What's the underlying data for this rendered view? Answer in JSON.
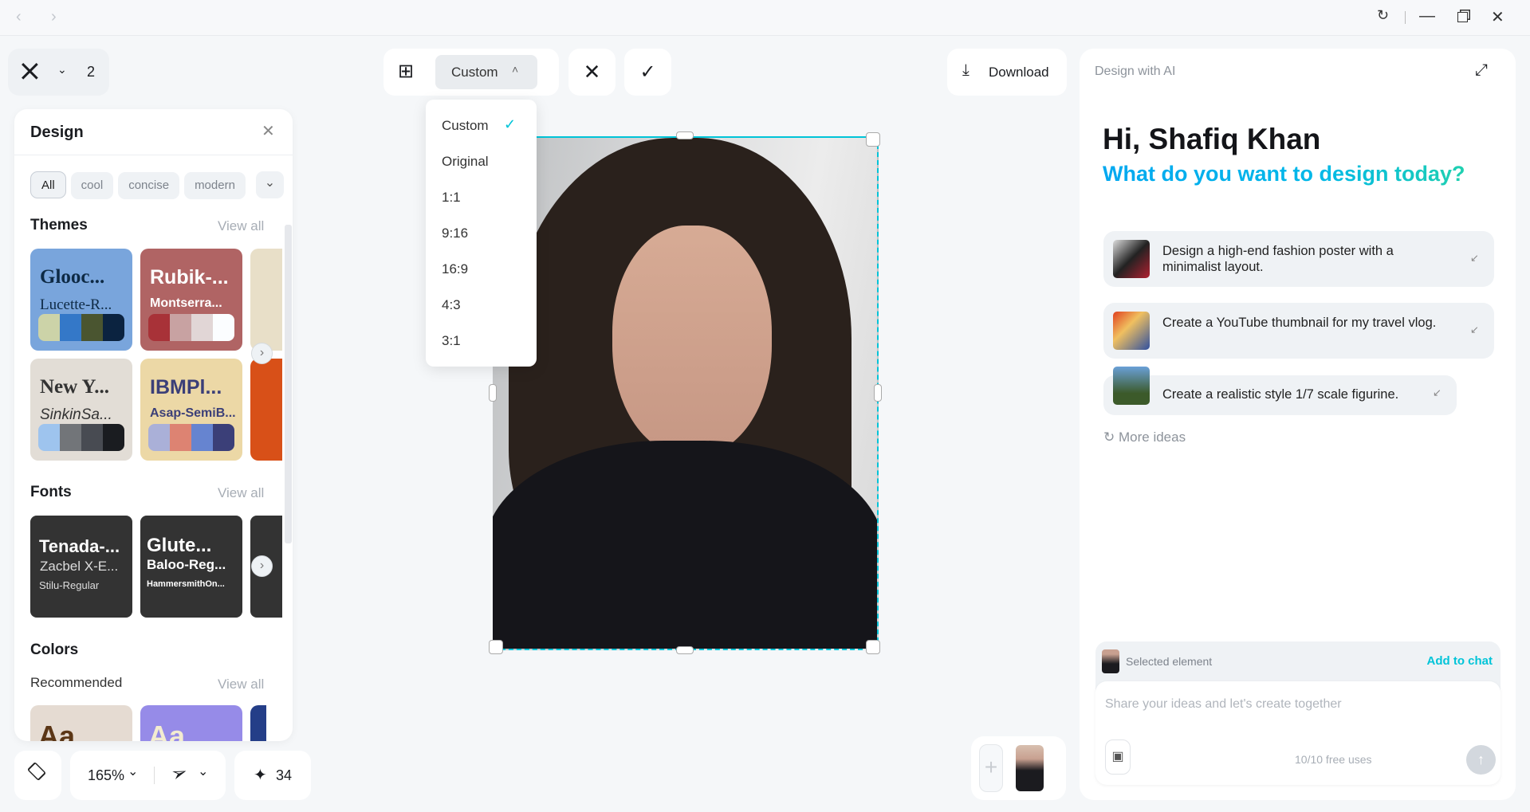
{
  "window": {
    "back_icon": "chevron-left",
    "forward_icon": "chevron-right",
    "controls": [
      "refresh",
      "minimize",
      "restore",
      "close"
    ]
  },
  "project": {
    "page_count": "2"
  },
  "design_panel": {
    "title": "Design",
    "filters": [
      "All",
      "cool",
      "concise",
      "modern"
    ],
    "themes": {
      "title": "Themes",
      "view_all": "View all",
      "items": [
        {
          "heading": "Glooc...",
          "sub": "Lucette-R...",
          "bg": "#79a5dc",
          "fg": "#0e2a45",
          "swatches": [
            "#ccd3a8",
            "#3478c8",
            "#4a5530",
            "#0b2340"
          ]
        },
        {
          "heading": "Rubik-...",
          "sub": "Montserra...",
          "bg": "#b06464",
          "fg": "#ffffff",
          "swatches": [
            "#a83238",
            "#c8a2a2",
            "#e1d6d6",
            "#fbfdff"
          ]
        },
        {
          "heading": "New Y...",
          "sub": "SinkinSa...",
          "bg": "#e2ddd6",
          "fg": "#333333",
          "swatches": [
            "#9ec4ee",
            "#727579",
            "#484b52",
            "#1a1c20"
          ]
        },
        {
          "heading": "IBMPl...",
          "sub": "Asap-SemiB...",
          "bg": "#ecd8a6",
          "fg": "#3b3f78",
          "swatches": [
            "#aab0d8",
            "#dd8372",
            "#6684d0",
            "#3b3f78"
          ]
        }
      ]
    },
    "fonts": {
      "title": "Fonts",
      "view_all": "View all",
      "items": [
        {
          "l1": "Tenada-...",
          "l2": "Zacbel X-E...",
          "l3": "Stilu-Regular"
        },
        {
          "l1": "Glute...",
          "l2": "Baloo-Reg...",
          "l3": "HammersmithOn..."
        }
      ]
    },
    "colors": {
      "title": "Colors",
      "recommended": "Recommended",
      "view_all": "View all",
      "sample": "Aa"
    }
  },
  "bottom_toolbar": {
    "zoom": "165%",
    "credits": "34"
  },
  "crop_toolbar": {
    "ratio": "Custom",
    "options": [
      "Custom",
      "Original",
      "1:1",
      "9:16",
      "16:9",
      "4:3",
      "3:1"
    ],
    "selected": "Custom"
  },
  "download_label": "Download",
  "ai_panel": {
    "title": "Design with AI",
    "greeting": "Hi, Shafiq Khan",
    "prompt": "What do you want to design today?",
    "suggestions": [
      "Design a high-end fashion poster with a minimalist layout.",
      "Create a YouTube thumbnail for my travel vlog.",
      "Create a realistic style 1/7 scale figurine."
    ],
    "more_ideas": "More ideas",
    "selected_element": "Selected element",
    "add_to_chat": "Add to chat",
    "input_placeholder": "Share your ideas and let's create together",
    "free_uses": "10/10 free uses"
  },
  "colors": {
    "accent": "#00c4d8",
    "gradient_start": "#00a8f0",
    "gradient_end": "#20d0b0"
  }
}
